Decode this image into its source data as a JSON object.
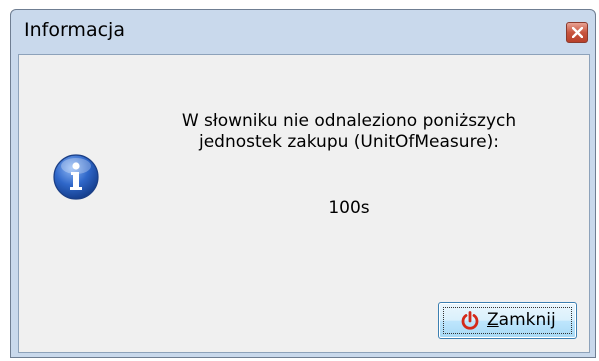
{
  "window": {
    "title": "Informacja"
  },
  "dialog": {
    "icon": "info-icon",
    "message_lines": [
      "W słowniku nie odnaleziono poniższych",
      "jednostek zakupu (UnitOfMeasure):"
    ],
    "value": "100s"
  },
  "buttons": {
    "close_mnemonic": "Z",
    "close_rest": "amknij",
    "close_icon": "power-icon"
  },
  "colors": {
    "titlebar": "#c9d9ec",
    "close_button": "#c8553f",
    "power_icon": "#d42a1a",
    "info_icon": "#2458b8"
  }
}
